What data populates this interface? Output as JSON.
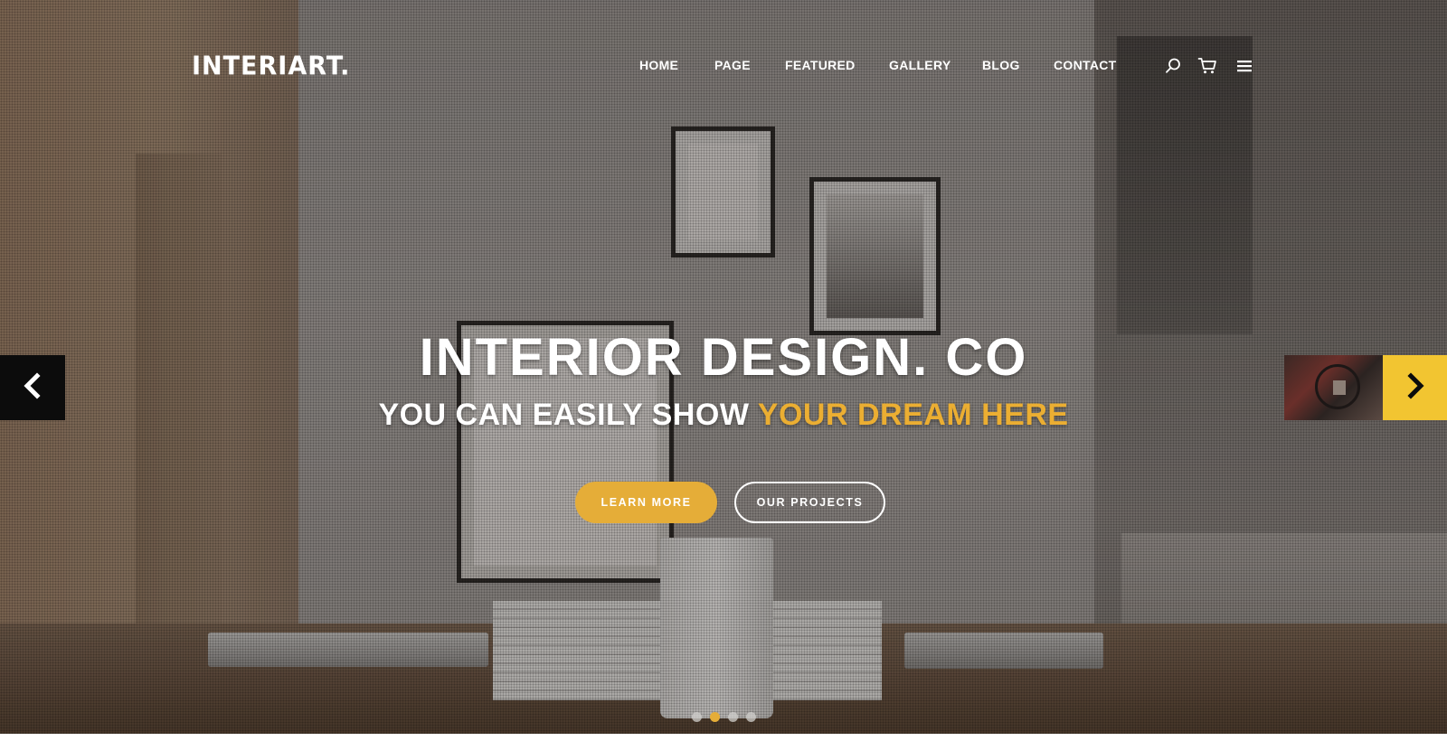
{
  "header": {
    "logo": "INTERIART."
  },
  "nav": {
    "items": [
      {
        "label": "HOME"
      },
      {
        "label": "PAGE"
      },
      {
        "label": "FEATURED"
      },
      {
        "label": "GALLERY"
      },
      {
        "label": "BLOG"
      },
      {
        "label": "CONTACT"
      }
    ],
    "icons": [
      "search-icon",
      "cart-icon",
      "menu-icon"
    ]
  },
  "hero": {
    "headline": "INTERIOR DESIGN. CO",
    "subline_prefix": "YOU CAN EASILY SHOW ",
    "subline_highlight": "YOUR DREAM HERE",
    "primary_button": "LEARN MORE",
    "secondary_button": "OUR PROJECTS"
  },
  "slider": {
    "prev_icon": "chevron-left-icon",
    "next_icon": "chevron-right-icon",
    "slide_count": 4,
    "active_slide": 2
  },
  "colors": {
    "accent": "#e5ad38",
    "next_arrow_bg": "#f2c531",
    "prev_arrow_bg": "#0c0c0c",
    "text_on_hero": "#ffffff"
  }
}
